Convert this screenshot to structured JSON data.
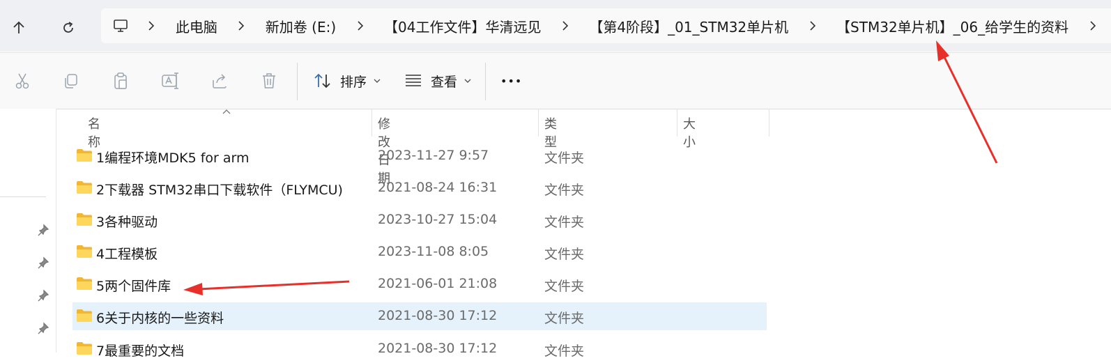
{
  "nav": {
    "up_icon": "arrow-up-icon",
    "refresh_icon": "refresh-icon"
  },
  "address_bar": {
    "root_icon": "computer-icon",
    "crumbs": [
      "此电脑",
      "新加卷 (E:)",
      "【04工作文件】华清远见",
      "【第4阶段】_01_STM32单片机",
      "【STM32单片机】_06_给学生的资料"
    ]
  },
  "toolbar": {
    "sort_label": "排序",
    "view_label": "查看",
    "more_label": "•••",
    "icons": [
      "cut-icon",
      "copy-icon",
      "paste-icon",
      "rename-icon",
      "share-icon",
      "delete-icon"
    ]
  },
  "columns": {
    "name": "名称",
    "modified": "修改日期",
    "type": "类型",
    "size": "大小"
  },
  "files": [
    {
      "name": "1编程环境MDK5 for arm",
      "modified": "2023-11-27 9:57",
      "type": "文件夹"
    },
    {
      "name": "2下载器 STM32串口下载软件（FLYMCU)",
      "modified": "2021-08-24 16:31",
      "type": "文件夹"
    },
    {
      "name": "3各种驱动",
      "modified": "2023-10-27 15:04",
      "type": "文件夹"
    },
    {
      "name": "4工程模板",
      "modified": "2023-11-08 8:05",
      "type": "文件夹"
    },
    {
      "name": "5两个固件库",
      "modified": "2021-06-01 21:08",
      "type": "文件夹"
    },
    {
      "name": "6关于内核的一些资料",
      "modified": "2021-08-30 17:12",
      "type": "文件夹",
      "selected": true
    },
    {
      "name": "7最重要的文档",
      "modified": "2021-08-30 17:12",
      "type": "文件夹"
    }
  ],
  "colors": {
    "selection": "#e5f1fb",
    "folder": "#f8c53a",
    "annotation_arrow": "#e8302a"
  }
}
